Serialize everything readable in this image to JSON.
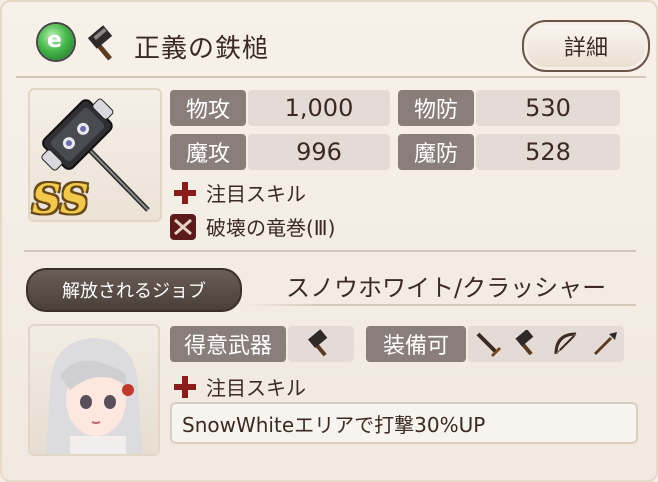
{
  "header": {
    "title": "正義の鉄槌",
    "detail_label": "詳細",
    "element_glyph": "e",
    "element_color": "#47b84b"
  },
  "weapon": {
    "rank": "SS",
    "stats": {
      "patk": {
        "label": "物攻",
        "value": "1,000"
      },
      "pdef": {
        "label": "物防",
        "value": "530"
      },
      "matk": {
        "label": "魔攻",
        "value": "996"
      },
      "mdef": {
        "label": "魔防",
        "value": "528"
      }
    },
    "focus_skill_label": "注目スキル",
    "skill_name": "破壊の竜巻(Ⅲ)"
  },
  "job": {
    "ribbon_label": "解放されるジョブ",
    "name": "スノウホワイト/クラッシャー",
    "favorite_weapon_label": "得意武器",
    "equippable_label": "装備可",
    "equippable_icons": [
      "sword-icon",
      "hammer-icon",
      "bow-icon",
      "spear-icon"
    ],
    "focus_skill_label": "注目スキル",
    "skill_text": "SnowWhiteエリアで打撃30%UP"
  },
  "colors": {
    "accent_red": "#8b1c1c",
    "label_gray": "#8a7e7b",
    "rank_gold": "#f2c94c"
  }
}
